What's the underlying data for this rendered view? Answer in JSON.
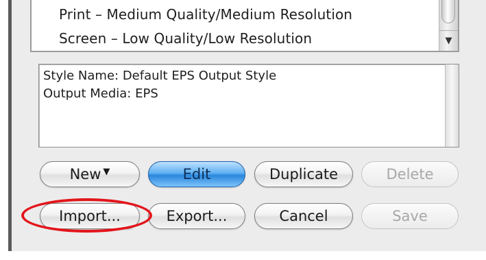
{
  "style_list": {
    "items": [
      "Print – Medium Quality/Medium Resolution",
      "Screen – Low Quality/Low Resolution"
    ],
    "scroll_down_arrow": "▼"
  },
  "style_info": {
    "style_name_line": "Style Name: Default EPS Output Style",
    "output_media_line": "Output Media: EPS"
  },
  "buttons": {
    "new_label": "New",
    "new_caret": "▼",
    "edit_label": "Edit",
    "duplicate_label": "Duplicate",
    "delete_label": "Delete",
    "import_label": "Import...",
    "export_label": "Export...",
    "cancel_label": "Cancel",
    "save_label": "Save"
  },
  "colors": {
    "default_button_accent": "#2b87dc",
    "annotation_ring": "#e3151b"
  }
}
